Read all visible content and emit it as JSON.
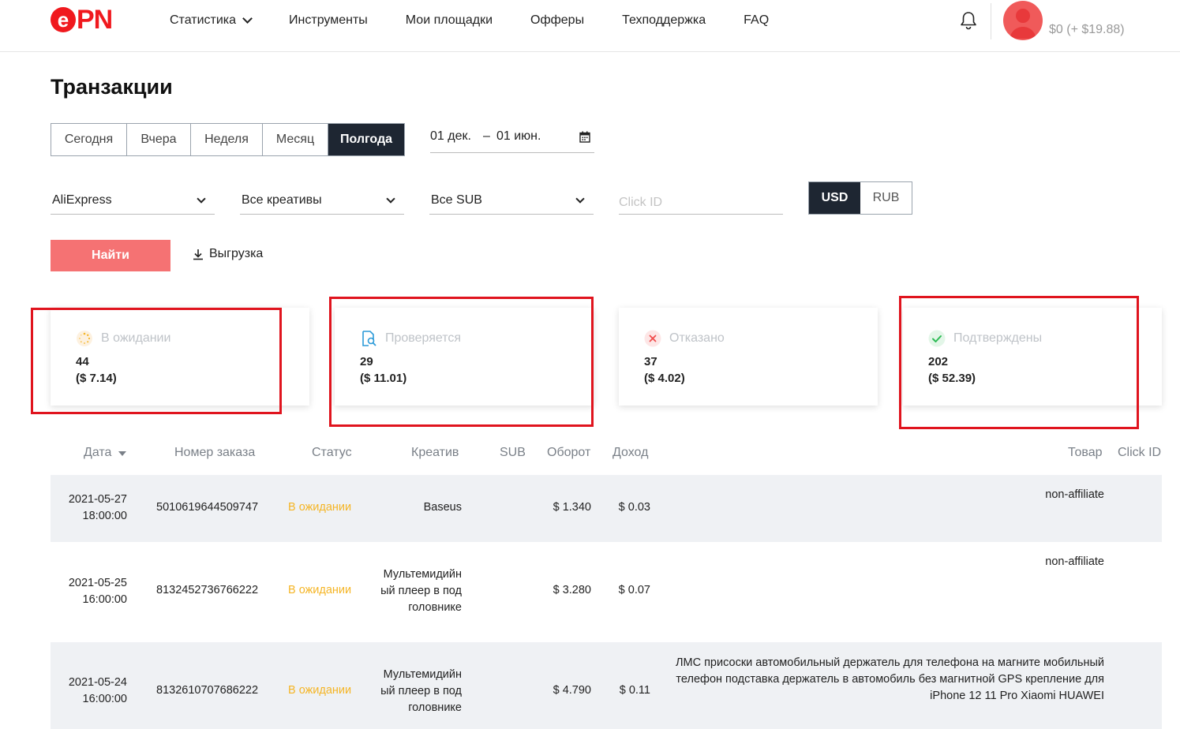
{
  "header": {
    "logo_e": "e",
    "logo_pn": "PN",
    "nav": [
      {
        "label": "Статистика",
        "dropdown": true
      },
      {
        "label": "Инструменты"
      },
      {
        "label": "Мои площадки"
      },
      {
        "label": "Офферы"
      },
      {
        "label": "Техподдержка"
      },
      {
        "label": "FAQ"
      }
    ],
    "balance": "$0 (+ $19.88)",
    "accent_color": "#f0191e"
  },
  "page": {
    "title": "Транзакции"
  },
  "filters": {
    "periods": [
      "Сегодня",
      "Вчера",
      "Неделя",
      "Месяц",
      "Полгода"
    ],
    "active_period": "Полгода",
    "date_from": "01 дек.",
    "date_separator": "–",
    "date_to": "01 июн.",
    "offer_select": "AliExpress",
    "creative_select": "Все креативы",
    "sub_select": "Все SUB",
    "click_id_placeholder": "Click ID",
    "currencies": [
      "USD",
      "RUB"
    ],
    "active_currency": "USD",
    "find_button": "Найти",
    "export_button": "Выгрузка"
  },
  "stats": [
    {
      "label": "В ожидании",
      "count": "44",
      "sum": "($ 7.14)",
      "icon": "pending-icon"
    },
    {
      "label": "Проверяется",
      "count": "29",
      "sum": "($ 11.01)",
      "icon": "review-icon"
    },
    {
      "label": "Отказано",
      "count": "37",
      "sum": "($ 4.02)",
      "icon": "rejected-icon"
    },
    {
      "label": "Подтверждены",
      "count": "202",
      "sum": "($ 52.39)",
      "icon": "confirmed-icon"
    }
  ],
  "table": {
    "columns": [
      "Дата",
      "Номер заказа",
      "Статус",
      "Креатив",
      "SUB",
      "Оборот",
      "Доход",
      "Товар",
      "Click ID"
    ],
    "rows": [
      {
        "date": "2021-05-27",
        "time": "18:00:00",
        "order": "5010619644509747",
        "status": "В ожидании",
        "creative": [
          "Baseus"
        ],
        "sub": "",
        "turnover": "$ 1.340",
        "income": "$ 0.03",
        "product": [
          "non-affiliate"
        ],
        "click_id": ""
      },
      {
        "date": "2021-05-25",
        "time": "16:00:00",
        "order": "8132452736766222",
        "status": "В ожидании",
        "creative": [
          "Мультемидийн",
          "ый плеер в под",
          "головнике"
        ],
        "sub": "",
        "turnover": "$ 3.280",
        "income": "$ 0.07",
        "product": [
          "non-affiliate"
        ],
        "click_id": ""
      },
      {
        "date": "2021-05-24",
        "time": "16:00:00",
        "order": "8132610707686222",
        "status": "В ожидании",
        "creative": [
          "Мультемидийн",
          "ый плеер в под",
          "головнике"
        ],
        "sub": "",
        "turnover": "$ 4.790",
        "income": "$ 0.11",
        "product": [
          "ЛМС присоски автомобильный держатель для телефона на магните мобильный",
          "телефон подставка держатель в автомобиль без магнитной GPS крепление для",
          "iPhone 12 11 Pro Xiaomi HUAWEI"
        ],
        "click_id": ""
      }
    ]
  }
}
